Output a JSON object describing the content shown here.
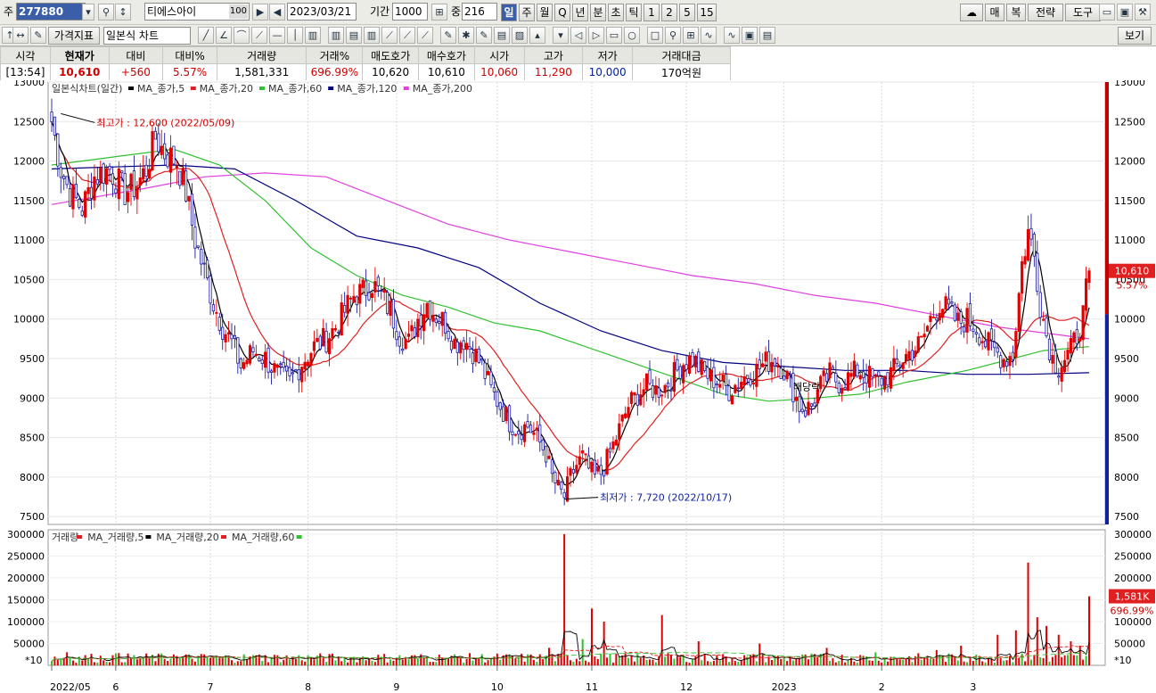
{
  "toolbar": {
    "code_label": "주",
    "code": "277880",
    "name": "티에스아이",
    "name_badge": "100",
    "date": "2023/03/21",
    "period_label": "기간",
    "period": "1000",
    "count_label": "중",
    "count": "216",
    "periods": [
      "일",
      "주",
      "월",
      "Q",
      "년",
      "분",
      "초",
      "틱",
      "1",
      "2",
      "5",
      "15"
    ],
    "active_period": "일",
    "right_buttons": [
      "매",
      "복",
      "전략",
      "도구"
    ],
    "indicator_button": "가격지표",
    "chart_type": "일본식 차트",
    "view_button": "보기"
  },
  "quote": {
    "headers": [
      "시각",
      "현재가",
      "대비",
      "대비%",
      "거래량",
      "거래%",
      "매도호가",
      "매수호가",
      "시가",
      "고가",
      "저가",
      "거래대금"
    ],
    "values": [
      "[13:54]",
      "10,610",
      "+560",
      "5.57%",
      "1,581,331",
      "696.99%",
      "10,620",
      "10,610",
      "10,060",
      "11,290",
      "10,000",
      "170억원"
    ]
  },
  "chart_data": {
    "type": "candlestick",
    "legend": {
      "title": "일본식차트(일간)",
      "items": [
        {
          "name": "MA_종가,5",
          "color": "#000000"
        },
        {
          "name": "MA_종가,20",
          "color": "#e02020"
        },
        {
          "name": "MA_종가,60",
          "color": "#30c030"
        },
        {
          "name": "MA_종가,120",
          "color": "#000080"
        },
        {
          "name": "MA_종가,200",
          "color": "#e040e0"
        }
      ]
    },
    "ylim": [
      7400,
      13000
    ],
    "yticks": [
      7500,
      8000,
      8500,
      9000,
      9500,
      10000,
      10500,
      11000,
      11500,
      12000,
      12500,
      13000
    ],
    "x_labels": [
      "2022/05",
      "6",
      "7",
      "8",
      "9",
      "10",
      "11",
      "12",
      "2023",
      "2",
      "3"
    ],
    "high_note": "최고가 : 12,600 (2022/05/09)",
    "low_note": "최저가 : 7,720 (2022/10/17)",
    "dividend_note": "배당락",
    "current_price": "10,610",
    "current_pct": "5.57%",
    "price_path": [
      [
        0,
        12500
      ],
      [
        3,
        11900
      ],
      [
        6,
        11600
      ],
      [
        10,
        11400
      ],
      [
        14,
        11800
      ],
      [
        19,
        11900
      ],
      [
        24,
        11600
      ],
      [
        28,
        11700
      ],
      [
        31,
        11900
      ],
      [
        34,
        12300
      ],
      [
        37,
        12100
      ],
      [
        41,
        12000
      ],
      [
        44,
        11600
      ],
      [
        47,
        11000
      ],
      [
        50,
        10600
      ],
      [
        53,
        10200
      ],
      [
        56,
        9900
      ],
      [
        59,
        9700
      ],
      [
        62,
        9400
      ],
      [
        66,
        9600
      ],
      [
        70,
        9500
      ],
      [
        74,
        9300
      ],
      [
        78,
        9200
      ],
      [
        82,
        9450
      ],
      [
        86,
        9650
      ],
      [
        90,
        9750
      ],
      [
        93,
        9900
      ],
      [
        96,
        10100
      ],
      [
        99,
        10300
      ],
      [
        102,
        10350
      ],
      [
        105,
        10450
      ],
      [
        108,
        10300
      ],
      [
        111,
        10100
      ],
      [
        114,
        9800
      ],
      [
        117,
        9700
      ],
      [
        120,
        10000
      ],
      [
        123,
        10200
      ],
      [
        126,
        10050
      ],
      [
        129,
        9950
      ],
      [
        132,
        9700
      ],
      [
        135,
        9750
      ],
      [
        138,
        9600
      ],
      [
        141,
        9400
      ],
      [
        144,
        9100
      ],
      [
        147,
        8900
      ],
      [
        150,
        8700
      ],
      [
        153,
        8600
      ],
      [
        156,
        8650
      ],
      [
        159,
        8500
      ],
      [
        162,
        8300
      ],
      [
        164,
        8000
      ],
      [
        166,
        7850
      ],
      [
        168,
        7750
      ],
      [
        170,
        8000
      ],
      [
        172,
        8150
      ],
      [
        174,
        8250
      ],
      [
        176,
        8100
      ],
      [
        178,
        8000
      ],
      [
        180,
        8050
      ],
      [
        183,
        8300
      ],
      [
        186,
        8600
      ],
      [
        189,
        8900
      ],
      [
        192,
        9050
      ],
      [
        195,
        9150
      ],
      [
        198,
        9100
      ],
      [
        201,
        9150
      ],
      [
        204,
        9300
      ],
      [
        207,
        9450
      ],
      [
        210,
        9500
      ],
      [
        213,
        9350
      ],
      [
        216,
        9250
      ],
      [
        219,
        9200
      ],
      [
        222,
        9100
      ],
      [
        225,
        9200
      ],
      [
        228,
        9300
      ],
      [
        231,
        9350
      ],
      [
        234,
        9450
      ],
      [
        237,
        9500
      ],
      [
        240,
        9350
      ],
      [
        243,
        9100
      ],
      [
        245,
        8900
      ],
      [
        247,
        8850
      ],
      [
        249,
        8900
      ],
      [
        252,
        9150
      ],
      [
        255,
        9300
      ],
      [
        258,
        9200
      ],
      [
        261,
        9250
      ],
      [
        264,
        9350
      ],
      [
        267,
        9300
      ],
      [
        270,
        9200
      ],
      [
        273,
        9250
      ],
      [
        276,
        9350
      ],
      [
        279,
        9500
      ],
      [
        282,
        9600
      ],
      [
        285,
        9700
      ],
      [
        288,
        10000
      ],
      [
        291,
        10200
      ],
      [
        294,
        10100
      ],
      [
        297,
        9950
      ],
      [
        300,
        10000
      ],
      [
        303,
        9900
      ],
      [
        306,
        9700
      ],
      [
        309,
        9600
      ],
      [
        312,
        9500
      ],
      [
        315,
        9550
      ],
      [
        318,
        10700
      ],
      [
        320,
        11100
      ],
      [
        322,
        10800
      ],
      [
        324,
        10200
      ],
      [
        326,
        9800
      ],
      [
        328,
        9500
      ],
      [
        330,
        9400
      ],
      [
        332,
        9500
      ],
      [
        334,
        9600
      ],
      [
        336,
        9800
      ],
      [
        338,
        10050
      ],
      [
        340,
        10610
      ]
    ],
    "ma120": [
      [
        0,
        11900
      ],
      [
        40,
        11950
      ],
      [
        60,
        11900
      ],
      [
        80,
        11500
      ],
      [
        100,
        11050
      ],
      [
        120,
        10900
      ],
      [
        140,
        10650
      ],
      [
        160,
        10200
      ],
      [
        180,
        9850
      ],
      [
        200,
        9600
      ],
      [
        220,
        9450
      ],
      [
        240,
        9400
      ],
      [
        260,
        9350
      ],
      [
        280,
        9350
      ],
      [
        300,
        9300
      ],
      [
        320,
        9300
      ],
      [
        340,
        9320
      ]
    ],
    "ma200": [
      [
        0,
        11450
      ],
      [
        30,
        11650
      ],
      [
        50,
        11800
      ],
      [
        70,
        11850
      ],
      [
        90,
        11800
      ],
      [
        110,
        11500
      ],
      [
        130,
        11200
      ],
      [
        150,
        11000
      ],
      [
        170,
        10850
      ],
      [
        190,
        10700
      ],
      [
        210,
        10550
      ],
      [
        230,
        10450
      ],
      [
        250,
        10300
      ],
      [
        270,
        10200
      ],
      [
        290,
        10050
      ],
      [
        310,
        9900
      ],
      [
        330,
        9800
      ],
      [
        340,
        9750
      ]
    ],
    "ma60": [
      [
        0,
        11950
      ],
      [
        20,
        12050
      ],
      [
        40,
        12150
      ],
      [
        55,
        11950
      ],
      [
        70,
        11500
      ],
      [
        85,
        10900
      ],
      [
        100,
        10550
      ],
      [
        115,
        10300
      ],
      [
        130,
        10150
      ],
      [
        145,
        9950
      ],
      [
        160,
        9850
      ],
      [
        175,
        9650
      ],
      [
        190,
        9450
      ],
      [
        205,
        9250
      ],
      [
        220,
        9050
      ],
      [
        235,
        8960
      ],
      [
        250,
        9000
      ],
      [
        265,
        9050
      ],
      [
        280,
        9200
      ],
      [
        300,
        9350
      ],
      [
        315,
        9500
      ],
      [
        325,
        9600
      ],
      [
        340,
        9650
      ]
    ],
    "volume": {
      "ylim": [
        0,
        310000
      ],
      "yticks": [
        50000,
        100000,
        150000,
        200000,
        250000,
        300000
      ],
      "unit_label": "*10",
      "legend": [
        {
          "name": "거래량",
          "color": "#e02020"
        },
        {
          "name": "MA_거래량,5",
          "color": "#000000"
        },
        {
          "name": "MA_거래량,20",
          "color": "#e02020"
        },
        {
          "name": "MA_거래량,60",
          "color": "#30c030"
        }
      ],
      "current_volume": "1,581K",
      "current_pct": "696.99%",
      "spikes": [
        [
          5,
          30000
        ],
        [
          22,
          28000
        ],
        [
          40,
          25000
        ],
        [
          68,
          25000
        ],
        [
          94,
          20000
        ],
        [
          128,
          18000
        ],
        [
          145,
          20000
        ],
        [
          163,
          40000
        ],
        [
          168,
          300000
        ],
        [
          174,
          60000
        ],
        [
          177,
          130000
        ],
        [
          181,
          100000
        ],
        [
          200,
          115000
        ],
        [
          212,
          55000
        ],
        [
          232,
          50000
        ],
        [
          254,
          40000
        ],
        [
          270,
          30000
        ],
        [
          290,
          35000
        ],
        [
          298,
          45000
        ],
        [
          310,
          70000
        ],
        [
          316,
          80000
        ],
        [
          320,
          235000
        ],
        [
          323,
          110000
        ],
        [
          326,
          90000
        ],
        [
          330,
          70000
        ],
        [
          334,
          55000
        ],
        [
          337,
          45000
        ],
        [
          340,
          158000
        ]
      ]
    }
  }
}
